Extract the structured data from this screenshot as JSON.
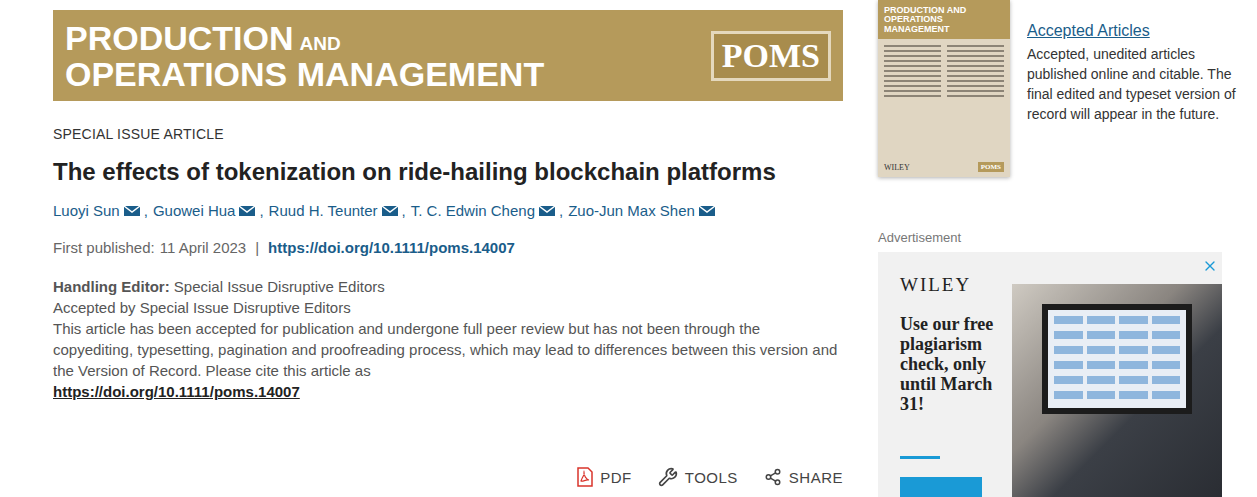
{
  "banner": {
    "line1": "PRODUCTION",
    "line1_small": "AND",
    "line2": "OPERATIONS MANAGEMENT",
    "logo": "POMS"
  },
  "article_type": "SPECIAL ISSUE ARTICLE",
  "title": "The effects of tokenization on ride-hailing blockchain platforms",
  "authors": [
    "Luoyi Sun",
    "Guowei Hua",
    "Ruud H. Teunter",
    "T. C. Edwin Cheng",
    "Zuo-Jun Max Shen"
  ],
  "published": {
    "label": "First published:",
    "date": "11 April 2023",
    "separator": "|",
    "doi": "https://doi.org/10.1111/poms.14007"
  },
  "editor_note": {
    "handling_label": "Handling Editor:",
    "handling_value": "Special Issue Disruptive Editors",
    "accepted": "Accepted by Special Issue Disruptive Editors",
    "notice": "This article has been accepted for publication and undergone full peer review but has not been through the copyediting, typesetting, pagination and proofreading process, which may lead to differences between this version and the Version of Record. Please cite this article as",
    "cite_link": "https://doi.org/10.1111/poms.14007"
  },
  "toolbar": [
    {
      "label": "PDF",
      "kind": "pdf"
    },
    {
      "label": "TOOLS",
      "kind": "tools"
    },
    {
      "label": "SHARE",
      "kind": "share"
    }
  ],
  "sidebar": {
    "cover": {
      "line1": "PRODUCTION AND",
      "line2": "OPERATIONS",
      "line3": "MANAGEMENT",
      "publisher": "WILEY",
      "logo": "POMS"
    },
    "link": "Accepted Articles",
    "description": "Accepted, unedited articles published online and citable. The final edited and typeset version of record will appear in the future."
  },
  "advertisement": {
    "label": "Advertisement",
    "brand": "WILEY",
    "headline": "Use our free plagiarism check, only until March 31!"
  }
}
